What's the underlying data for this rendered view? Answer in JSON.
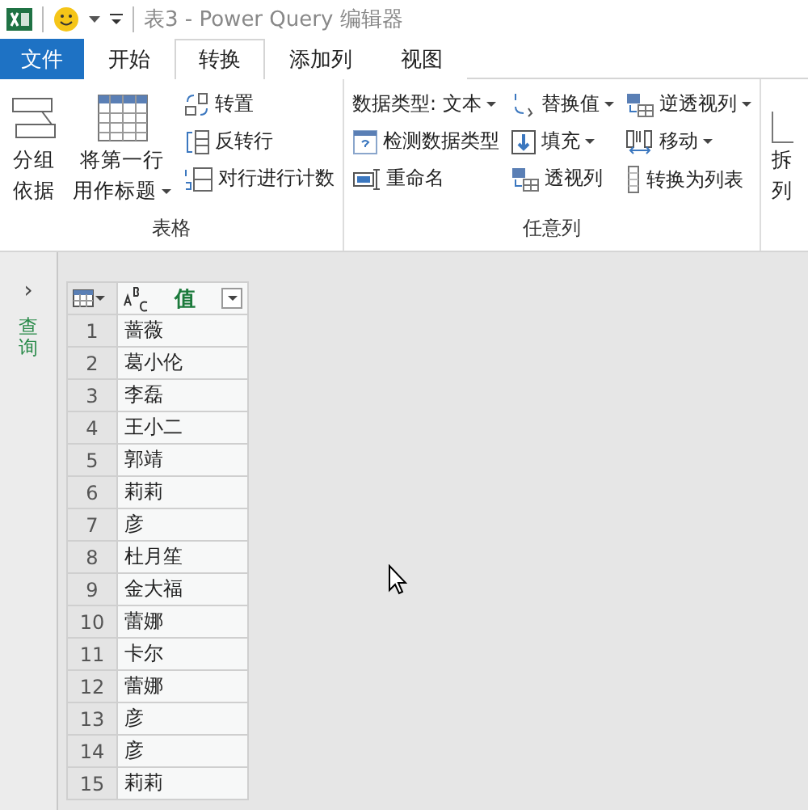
{
  "title_bar": {
    "title": "表3 - Power Query 编辑器"
  },
  "tabs": [
    {
      "label": "文件",
      "kind": "file",
      "selected": false
    },
    {
      "label": "开始",
      "kind": "tab",
      "selected": false
    },
    {
      "label": "转换",
      "kind": "tab",
      "selected": true
    },
    {
      "label": "添加列",
      "kind": "tab",
      "selected": false
    },
    {
      "label": "视图",
      "kind": "tab",
      "selected": false
    }
  ],
  "ribbon": {
    "groups": [
      {
        "label": "表格",
        "large": [
          {
            "lines": [
              "分组",
              "依据"
            ],
            "kind": "group",
            "dropdown": false
          },
          {
            "lines": [
              "将第一行",
              "用作标题"
            ],
            "kind": "table",
            "dropdown": true
          }
        ],
        "columns": [
          [
            {
              "label": "转置",
              "kind": "transpose",
              "dropdown": false
            },
            {
              "label": "反转行",
              "kind": "reverse",
              "dropdown": false
            },
            {
              "label": "对行进行计数",
              "kind": "count",
              "dropdown": false
            }
          ]
        ]
      },
      {
        "label": "任意列",
        "columns": [
          [
            {
              "label": "数据类型: 文本",
              "kind": "none",
              "dropdown": true
            },
            {
              "label": "检测数据类型",
              "kind": "detect",
              "dropdown": false
            },
            {
              "label": "重命名",
              "kind": "rename",
              "dropdown": false
            }
          ],
          [
            {
              "label": "替换值",
              "kind": "replace",
              "dropdown": true
            },
            {
              "label": "填充",
              "kind": "fill",
              "dropdown": true
            },
            {
              "label": "透视列",
              "kind": "pivot",
              "dropdown": false
            }
          ],
          [
            {
              "label": "逆透视列",
              "kind": "pivot",
              "dropdown": true
            },
            {
              "label": "移动",
              "kind": "move",
              "dropdown": true
            },
            {
              "label": "转换为列表",
              "kind": "list",
              "dropdown": false
            }
          ]
        ]
      },
      {
        "large": [
          {
            "lines": [
              "拆",
              "列"
            ],
            "kind": "split",
            "dropdown": false
          }
        ]
      }
    ]
  },
  "sidebar": {
    "toggle": "›",
    "label": "查询"
  },
  "table": {
    "column": "值",
    "rows": [
      {
        "index": "1",
        "value": "蔷薇"
      },
      {
        "index": "2",
        "value": "葛小伦"
      },
      {
        "index": "3",
        "value": "李磊"
      },
      {
        "index": "4",
        "value": "王小二"
      },
      {
        "index": "5",
        "value": "郭靖"
      },
      {
        "index": "6",
        "value": "莉莉"
      },
      {
        "index": "7",
        "value": "彦"
      },
      {
        "index": "8",
        "value": "杜月笙"
      },
      {
        "index": "9",
        "value": "金大福"
      },
      {
        "index": "10",
        "value": "蕾娜"
      },
      {
        "index": "11",
        "value": "卡尔"
      },
      {
        "index": "12",
        "value": "蕾娜"
      },
      {
        "index": "13",
        "value": "彦"
      },
      {
        "index": "14",
        "value": "彦"
      },
      {
        "index": "15",
        "value": "莉莉"
      }
    ]
  }
}
